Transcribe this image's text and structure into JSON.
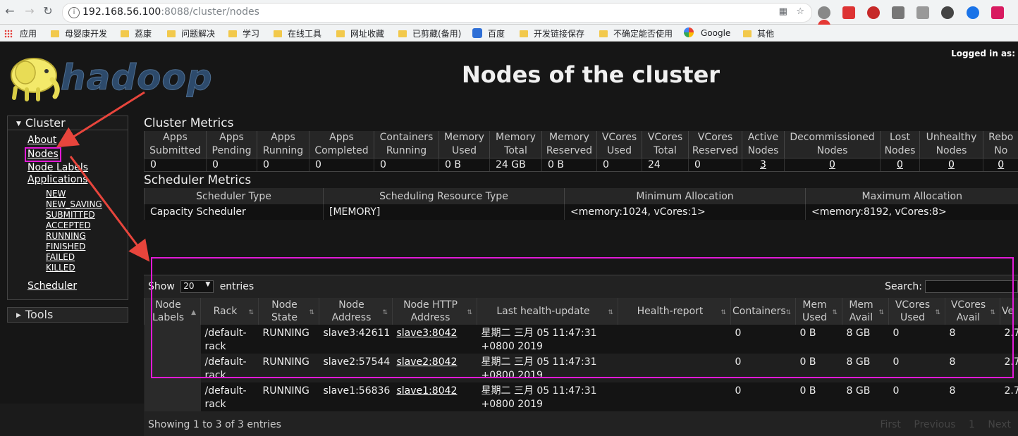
{
  "browser": {
    "url_host": "192.168.56.100",
    "url_rest": ":8088/cluster/nodes",
    "bookmarks": [
      {
        "label": "应用",
        "icon": "apps-grid-icon"
      },
      {
        "label": "母婴康开发",
        "icon": "folder-icon"
      },
      {
        "label": "荔康",
        "icon": "folder-icon"
      },
      {
        "label": "问题解决",
        "icon": "folder-icon"
      },
      {
        "label": "学习",
        "icon": "folder-icon"
      },
      {
        "label": "在线工具",
        "icon": "folder-icon"
      },
      {
        "label": "网址收藏",
        "icon": "folder-icon"
      },
      {
        "label": "已剪藏(备用)",
        "icon": "folder-icon"
      },
      {
        "label": "百度",
        "icon": "baidu-paw-icon"
      },
      {
        "label": "开发链接保存",
        "icon": "folder-icon"
      },
      {
        "label": "不确定能否使用",
        "icon": "folder-icon"
      },
      {
        "label": "Google",
        "icon": "google-icon"
      },
      {
        "label": "其他",
        "icon": "folder-icon"
      }
    ]
  },
  "header": {
    "logged_in": "Logged in as:",
    "logo_text": "hadoop",
    "title": "Nodes of the cluster"
  },
  "sidebar": {
    "cluster_label": "Cluster",
    "about": "About",
    "nodes": "Nodes",
    "node_labels": "Node Labels",
    "applications": "Applications",
    "app_states": [
      "NEW",
      "NEW_SAVING",
      "SUBMITTED",
      "ACCEPTED",
      "RUNNING",
      "FINISHED",
      "FAILED",
      "KILLED"
    ],
    "scheduler": "Scheduler",
    "tools_label": "Tools"
  },
  "cluster_metrics": {
    "title": "Cluster Metrics",
    "headers": [
      [
        "Apps",
        "Submitted"
      ],
      [
        "Apps",
        "Pending"
      ],
      [
        "Apps",
        "Running"
      ],
      [
        "Apps",
        "Completed"
      ],
      [
        "Containers",
        "Running"
      ],
      [
        "Memory",
        "Used"
      ],
      [
        "Memory",
        "Total"
      ],
      [
        "Memory",
        "Reserved"
      ],
      [
        "VCores",
        "Used"
      ],
      [
        "VCores",
        "Total"
      ],
      [
        "VCores",
        "Reserved"
      ],
      [
        "Active",
        "Nodes"
      ],
      [
        "Decommissioned",
        "Nodes"
      ],
      [
        "Lost",
        "Nodes"
      ],
      [
        "Unhealthy",
        "Nodes"
      ],
      [
        "Rebo",
        "No"
      ]
    ],
    "values": [
      "0",
      "0",
      "0",
      "0",
      "0",
      "0 B",
      "24 GB",
      "0 B",
      "0",
      "24",
      "0",
      "3",
      "0",
      "0",
      "0",
      "0"
    ]
  },
  "scheduler_metrics": {
    "title": "Scheduler Metrics",
    "headers": [
      "Scheduler Type",
      "Scheduling Resource Type",
      "Minimum Allocation",
      "Maximum Allocation"
    ],
    "values": [
      "Capacity Scheduler",
      "[MEMORY]",
      "<memory:1024, vCores:1>",
      "<memory:8192, vCores:8>"
    ]
  },
  "nodes_table": {
    "show_label": "Show",
    "page_size": "20",
    "entries_label": "entries",
    "search_label": "Search:",
    "headers": [
      [
        "Node",
        "Labels"
      ],
      [
        "Rack",
        ""
      ],
      [
        "Node",
        "State"
      ],
      [
        "Node",
        "Address"
      ],
      [
        "Node HTTP",
        "Address"
      ],
      [
        "Last health-update",
        ""
      ],
      [
        "Health-report",
        ""
      ],
      [
        "Containers",
        ""
      ],
      [
        "Mem",
        "Used"
      ],
      [
        "Mem",
        "Avail"
      ],
      [
        "VCores",
        "Used"
      ],
      [
        "VCores",
        "Avail"
      ],
      [
        "Ve",
        ""
      ]
    ],
    "rows": [
      {
        "labels": "",
        "rack1": "/default-",
        "rack2": "rack",
        "state": "RUNNING",
        "address": "slave3:42611",
        "http": "slave3:8042",
        "health1": "星期二 三月 05 11:47:31",
        "health2": "+0800 2019",
        "report": "",
        "containers": "0",
        "mem_used": "0 B",
        "mem_avail": "8 GB",
        "vc_used": "0",
        "vc_avail": "8",
        "ver": "2.7"
      },
      {
        "labels": "",
        "rack1": "/default-",
        "rack2": "rack",
        "state": "RUNNING",
        "address": "slave2:57544",
        "http": "slave2:8042",
        "health1": "星期二 三月 05 11:47:31",
        "health2": "+0800 2019",
        "report": "",
        "containers": "0",
        "mem_used": "0 B",
        "mem_avail": "8 GB",
        "vc_used": "0",
        "vc_avail": "8",
        "ver": "2.7"
      },
      {
        "labels": "",
        "rack1": "/default-",
        "rack2": "rack",
        "state": "RUNNING",
        "address": "slave1:56836",
        "http": "slave1:8042",
        "health1": "星期二 三月 05 11:47:31",
        "health2": "+0800 2019",
        "report": "",
        "containers": "0",
        "mem_used": "0 B",
        "mem_avail": "8 GB",
        "vc_used": "0",
        "vc_avail": "8",
        "ver": "2.7"
      }
    ],
    "info": "Showing 1 to 3 of 3 entries",
    "paging": [
      "First",
      "Previous",
      "1",
      "Next"
    ]
  },
  "colors": {
    "annotation": "#e21ad7"
  }
}
